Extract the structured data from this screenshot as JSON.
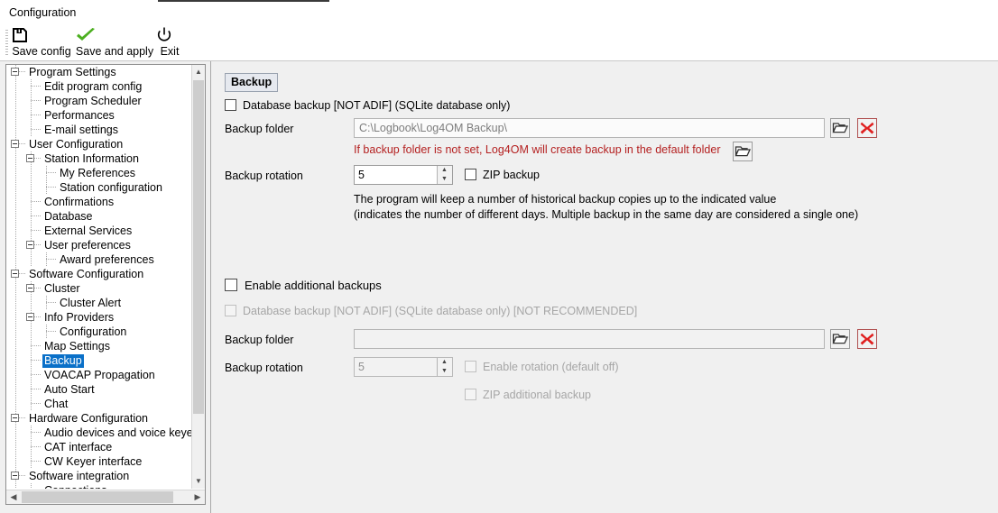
{
  "window": {
    "title": "Configuration"
  },
  "toolbar": {
    "buttons": [
      {
        "label": "Save config",
        "icon": "floppy-disk-icon"
      },
      {
        "label": "Save and apply",
        "icon": "green-check-icon"
      },
      {
        "label": "Exit",
        "icon": "power-icon"
      }
    ]
  },
  "sidebar": {
    "items": [
      {
        "label": "Program Settings",
        "level": 0,
        "expander": true,
        "selected": false
      },
      {
        "label": "Edit program config",
        "level": 1,
        "expander": false,
        "selected": false
      },
      {
        "label": "Program Scheduler",
        "level": 1,
        "expander": false,
        "selected": false
      },
      {
        "label": "Performances",
        "level": 1,
        "expander": false,
        "selected": false
      },
      {
        "label": "E-mail settings",
        "level": 1,
        "expander": false,
        "selected": false
      },
      {
        "label": "User Configuration",
        "level": 0,
        "expander": true,
        "selected": false
      },
      {
        "label": "Station Information",
        "level": 1,
        "expander": true,
        "selected": false
      },
      {
        "label": "My References",
        "level": 2,
        "expander": false,
        "selected": false
      },
      {
        "label": "Station configuration",
        "level": 2,
        "expander": false,
        "selected": false
      },
      {
        "label": "Confirmations",
        "level": 1,
        "expander": false,
        "selected": false
      },
      {
        "label": "Database",
        "level": 1,
        "expander": false,
        "selected": false
      },
      {
        "label": "External Services",
        "level": 1,
        "expander": false,
        "selected": false
      },
      {
        "label": "User preferences",
        "level": 1,
        "expander": true,
        "selected": false
      },
      {
        "label": "Award preferences",
        "level": 2,
        "expander": false,
        "selected": false
      },
      {
        "label": "Software Configuration",
        "level": 0,
        "expander": true,
        "selected": false
      },
      {
        "label": "Cluster",
        "level": 1,
        "expander": true,
        "selected": false
      },
      {
        "label": "Cluster Alert",
        "level": 2,
        "expander": false,
        "selected": false
      },
      {
        "label": "Info Providers",
        "level": 1,
        "expander": true,
        "selected": false
      },
      {
        "label": "Configuration",
        "level": 2,
        "expander": false,
        "selected": false
      },
      {
        "label": "Map Settings",
        "level": 1,
        "expander": false,
        "selected": false
      },
      {
        "label": "Backup",
        "level": 1,
        "expander": false,
        "selected": true
      },
      {
        "label": "VOACAP Propagation",
        "level": 1,
        "expander": false,
        "selected": false
      },
      {
        "label": "Auto Start",
        "level": 1,
        "expander": false,
        "selected": false
      },
      {
        "label": "Chat",
        "level": 1,
        "expander": false,
        "selected": false
      },
      {
        "label": "Hardware Configuration",
        "level": 0,
        "expander": true,
        "selected": false
      },
      {
        "label": "Audio devices and voice keye",
        "level": 1,
        "expander": false,
        "selected": false
      },
      {
        "label": "CAT interface",
        "level": 1,
        "expander": false,
        "selected": false
      },
      {
        "label": "CW Keyer interface",
        "level": 1,
        "expander": false,
        "selected": false
      },
      {
        "label": "Software integration",
        "level": 0,
        "expander": true,
        "selected": false
      },
      {
        "label": "Connections",
        "level": 1,
        "expander": false,
        "selected": false
      }
    ],
    "selection_color": "#0a70c8"
  },
  "main": {
    "header": "Backup",
    "primary": {
      "enable_checkbox_label": "Database backup [NOT ADIF] (SQLite database only)",
      "enable_checked": false,
      "folder_label": "Backup folder",
      "folder_value": "C:\\Logbook\\Log4OM Backup\\",
      "folder_browse_icon": "folder-open-icon",
      "folder_clear_icon": "red-x-icon",
      "warning_text": "If backup folder is not set, Log4OM will create backup in the default folder",
      "warning_browse_icon": "folder-open-icon",
      "warning_color": "#b42020",
      "rotation_label": "Backup rotation",
      "rotation_value": "5",
      "zip_checkbox_label": "ZIP backup",
      "zip_checked": false,
      "help_line_1": "The program will keep a number of historical backup copies up to the indicated value",
      "help_line_2": "(indicates the number of different days. Multiple backup in the same day are considered a single one)"
    },
    "additional": {
      "enable_checkbox_label": "Enable additional backups",
      "enable_checked": false,
      "database_checkbox_label": "Database backup [NOT ADIF] (SQLite database only) [NOT RECOMMENDED]",
      "database_checked": false,
      "database_disabled": true,
      "folder_label": "Backup folder",
      "folder_value": "",
      "folder_browse_icon": "folder-open-icon",
      "folder_clear_icon": "red-x-icon",
      "rotation_label": "Backup rotation",
      "rotation_value": "5",
      "rotation_disabled": true,
      "enable_rotation_label": "Enable rotation (default off)",
      "enable_rotation_checked": false,
      "zip_checkbox_label": "ZIP additional backup",
      "zip_checked": false
    }
  }
}
